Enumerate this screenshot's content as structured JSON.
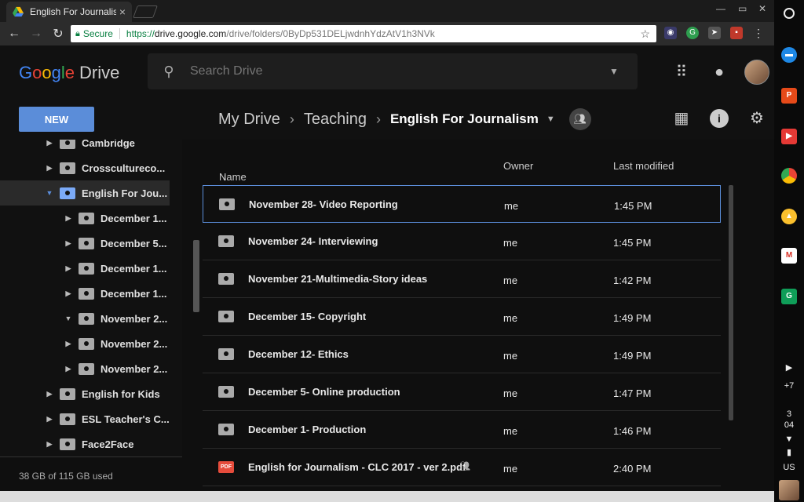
{
  "browser": {
    "tab_title": "English For Journalism",
    "secure_label": "Secure",
    "url_scheme": "https://",
    "url_host": "drive.google.com",
    "url_path": "/drive/folders/0ByDp531DELjwdnhYdzAtV1h3NVk"
  },
  "drive": {
    "logo_google": "Google",
    "logo_drive": "Drive",
    "search_placeholder": "Search Drive",
    "new_label": "NEW",
    "breadcrumbs": [
      "My Drive",
      "Teaching",
      "English For Journalism"
    ],
    "quota": "38 GB of 115 GB used"
  },
  "sidebar": {
    "items": [
      {
        "label": "Cambridge"
      },
      {
        "label": "Crossculturecо..."
      },
      {
        "label": "English For Jou..."
      },
      {
        "label": "December 1..."
      },
      {
        "label": "December 5..."
      },
      {
        "label": "December 1..."
      },
      {
        "label": "December 1..."
      },
      {
        "label": "November 2..."
      },
      {
        "label": "November 2..."
      },
      {
        "label": "November 2..."
      },
      {
        "label": "English for Kids"
      },
      {
        "label": "ESL Teacher's C..."
      },
      {
        "label": "Face2Face"
      }
    ]
  },
  "list": {
    "col_name": "Name",
    "col_owner": "Owner",
    "col_modified": "Last modified",
    "rows": [
      {
        "name": "November 28- Video Reporting",
        "owner": "me",
        "modified": "1:45 PM"
      },
      {
        "name": "November 24- Interviewing",
        "owner": "me",
        "modified": "1:45 PM"
      },
      {
        "name": "November 21-Multimedia-Story ideas",
        "owner": "me",
        "modified": "1:42 PM"
      },
      {
        "name": "December 15- Copyright",
        "owner": "me",
        "modified": "1:49 PM"
      },
      {
        "name": "December 12- Ethics",
        "owner": "me",
        "modified": "1:49 PM"
      },
      {
        "name": "December 5- Online production",
        "owner": "me",
        "modified": "1:47 PM"
      },
      {
        "name": "December 1- Production",
        "owner": "me",
        "modified": "1:46 PM"
      },
      {
        "name": "English for Journalism - CLC 2017 - ver 2.pdf",
        "owner": "me",
        "modified": "2:40 PM"
      }
    ]
  },
  "shelf": {
    "notif": "+7",
    "date_day": "3",
    "date_time": "04",
    "locale": "US"
  },
  "pdf_badge": "PDF"
}
